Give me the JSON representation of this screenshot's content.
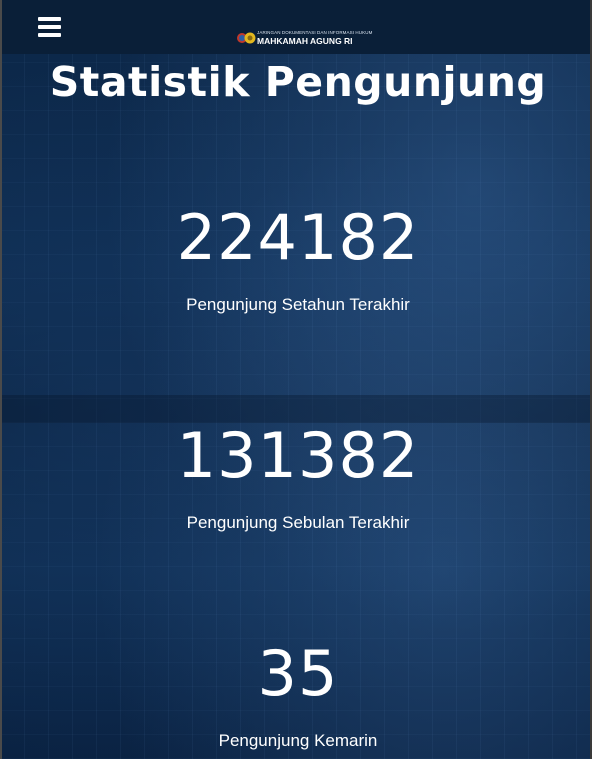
{
  "header": {
    "logo_small_text": "JARINGAN DOKUMENTASI DAN INFORMASI HUKUM",
    "logo_big_text": "MAHKAMAH AGUNG RI"
  },
  "page": {
    "title": "Statistik Pengunjung"
  },
  "stats": [
    {
      "value": "224182",
      "label": "Pengunjung Setahun Terakhir"
    },
    {
      "value": "131382",
      "label": "Pengunjung Sebulan Terakhir"
    },
    {
      "value": "35",
      "label": "Pengunjung Kemarin"
    }
  ],
  "colors": {
    "background": "#0d2442",
    "header_bar": "#0a1f38",
    "text": "#ffffff"
  }
}
